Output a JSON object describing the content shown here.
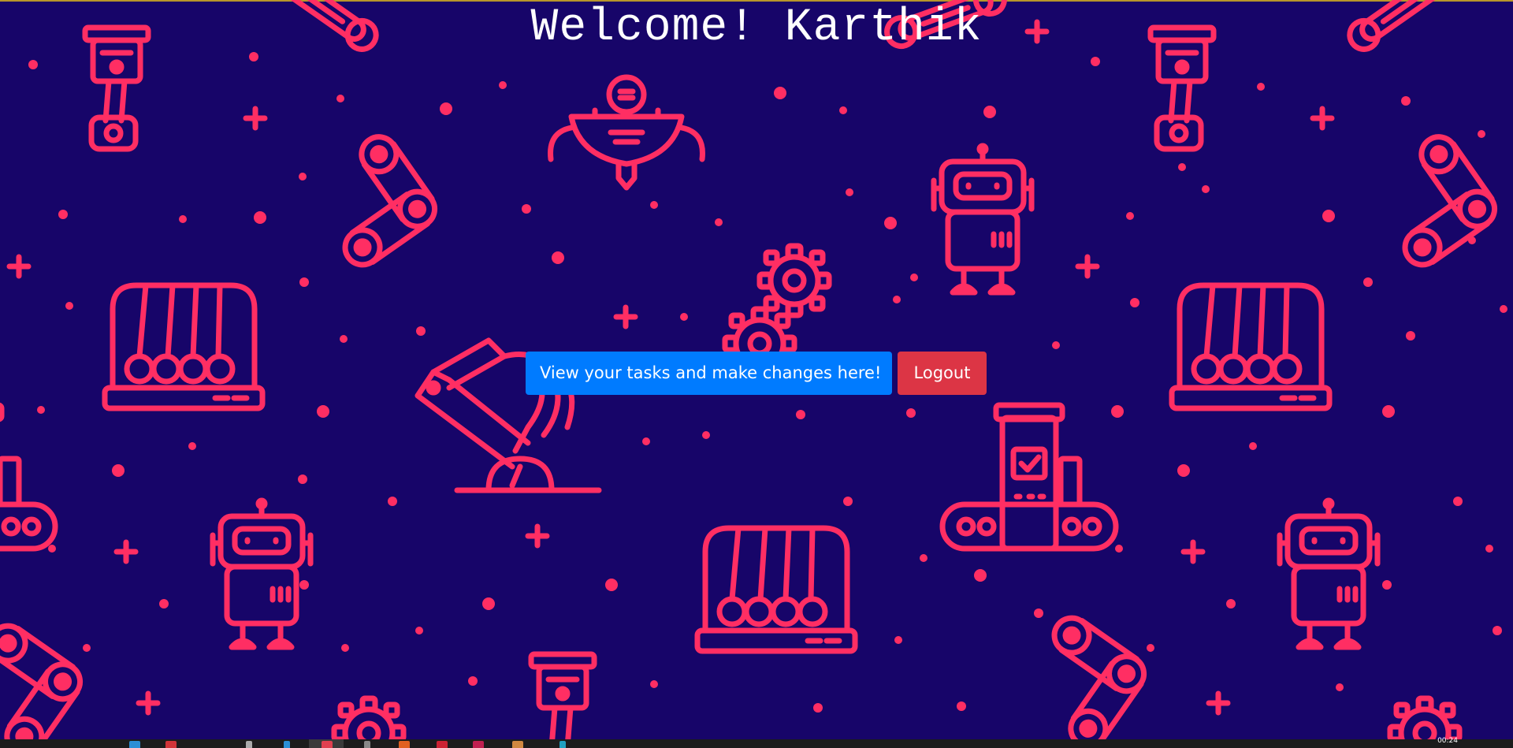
{
  "page": {
    "welcome_text": "Welcome! Karthik"
  },
  "actions": {
    "view_tasks_label": "View your tasks and make changes here!",
    "logout_label": "Logout"
  },
  "taskbar": {
    "clock": "00:24"
  },
  "colors": {
    "background": "#170569",
    "pattern": "#ff2e63",
    "primary_button": "#007bff",
    "danger_button": "#dc3545",
    "text": "#ffffff"
  },
  "background_icons": [
    "piston-icon",
    "robot-icon",
    "chain-link-icon",
    "newtons-cradle-icon",
    "gear-icon",
    "robotic-arm-icon",
    "conveyor-belt-icon",
    "wrench-icon",
    "plus-icon",
    "dot-icon"
  ]
}
